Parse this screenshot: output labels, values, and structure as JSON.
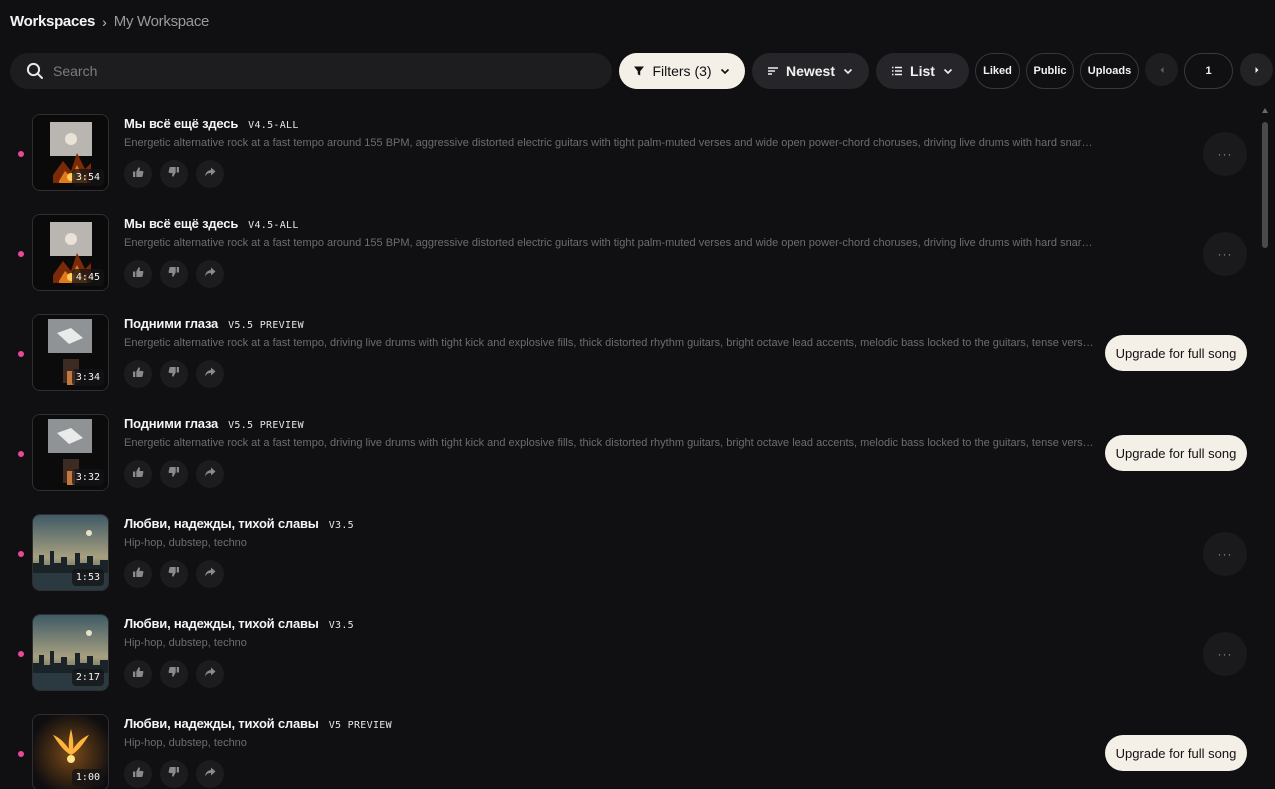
{
  "breadcrumb": {
    "root": "Workspaces",
    "current": "My Workspace"
  },
  "search": {
    "placeholder": "Search"
  },
  "toolbar": {
    "filters_label": "Filters (3)",
    "sort_label": "Newest",
    "view_label": "List",
    "liked_label": "Liked",
    "public_label": "Public",
    "uploads_label": "Uploads",
    "page": "1"
  },
  "songs": [
    {
      "title": "Мы всё ещё здесь",
      "version": "V4.5-ALL",
      "description": "Energetic alternative rock at a fast tempo around 155 BPM, aggressive distorted electric guitars with tight palm-muted verses and wide open power-chord choruses, driving live drums with hard snare hits and expl...",
      "duration": "3:54",
      "action": "more",
      "thumb": "fire"
    },
    {
      "title": "Мы всё ещё здесь",
      "version": "V4.5-ALL",
      "description": "Energetic alternative rock at a fast tempo around 155 BPM, aggressive distorted electric guitars with tight palm-muted verses and wide open power-chord choruses, driving live drums with hard snare hits and expl...",
      "duration": "4:45",
      "action": "more",
      "thumb": "fire"
    },
    {
      "title": "Подними глаза",
      "version": "V5.5 PREVIEW",
      "description": "Energetic alternative rock at a fast tempo, driving live drums with tight kick and explosive fills, thick distorted rhythm guitars, bright octave lead accents, melodic bass locked to the guitars, tense verses that build i...",
      "duration": "3:34",
      "action": "upgrade",
      "thumb": "paper"
    },
    {
      "title": "Подними глаза",
      "version": "V5.5 PREVIEW",
      "description": "Energetic alternative rock at a fast tempo, driving live drums with tight kick and explosive fills, thick distorted rhythm guitars, bright octave lead accents, melodic bass locked to the guitars, tense verses that build i...",
      "duration": "3:32",
      "action": "upgrade",
      "thumb": "paper"
    },
    {
      "title": "Любви, надежды, тихой славы",
      "version": "V3.5",
      "description": "Hip-hop, dubstep, techno",
      "duration": "1:53",
      "action": "more",
      "thumb": "city"
    },
    {
      "title": "Любви, надежды, тихой славы",
      "version": "V3.5",
      "description": "Hip-hop, dubstep, techno",
      "duration": "2:17",
      "action": "more",
      "thumb": "city"
    },
    {
      "title": "Любви, надежды, тихой славы",
      "version": "V5 PREVIEW",
      "description": "Hip-hop, dubstep, techno",
      "duration": "1:00",
      "action": "upgrade",
      "thumb": "bird"
    }
  ],
  "upgrade_label": "Upgrade for full song",
  "more_label": "···",
  "colors": {
    "accent_dot": "#e8479a",
    "light_pill": "#f4efe7",
    "background": "#101012"
  }
}
